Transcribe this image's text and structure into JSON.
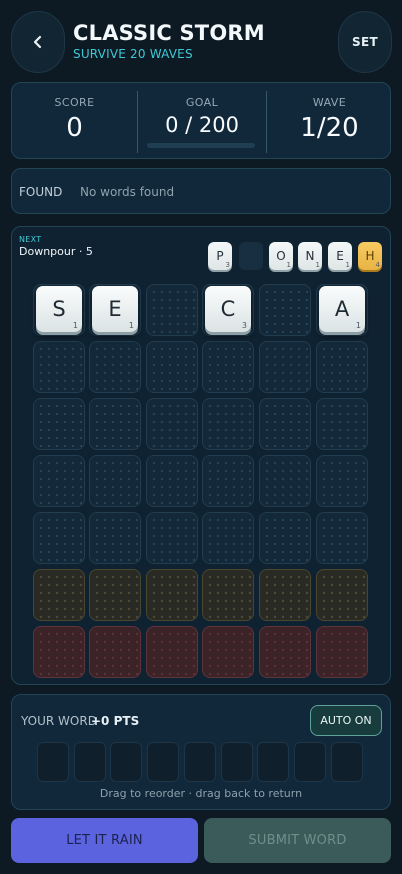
{
  "header": {
    "title": "CLASSIC STORM",
    "subtitle": "SURVIVE 20 WAVES",
    "back_icon": "chevron-left-icon",
    "set_label": "SET"
  },
  "stats": {
    "score_label": "SCORE",
    "score_value": "0",
    "goal_label": "GOAL",
    "goal_value": "0 / 200",
    "goal_progress": 0,
    "wave_label": "WAVE",
    "wave_value": "1/20"
  },
  "found": {
    "label": "FOUND",
    "text": "No words found"
  },
  "next": {
    "label": "NEXT",
    "name": "Downpour · 5",
    "queue": [
      {
        "letter": "P",
        "points": "3",
        "style": "white"
      },
      {
        "letter": "",
        "points": "",
        "style": "empty"
      },
      {
        "letter": "O",
        "points": "1",
        "style": "white"
      },
      {
        "letter": "N",
        "points": "1",
        "style": "white"
      },
      {
        "letter": "E",
        "points": "1",
        "style": "white"
      },
      {
        "letter": "H",
        "points": "4",
        "style": "gold"
      }
    ]
  },
  "board": {
    "columns": 6,
    "rows": 7,
    "row_states": [
      "normal",
      "normal",
      "normal",
      "normal",
      "normal",
      "warn",
      "danger"
    ],
    "tiles": [
      {
        "row": 0,
        "col": 0,
        "letter": "S",
        "points": "1"
      },
      {
        "row": 0,
        "col": 1,
        "letter": "E",
        "points": "1"
      },
      {
        "row": 0,
        "col": 3,
        "letter": "C",
        "points": "3"
      },
      {
        "row": 0,
        "col": 5,
        "letter": "A",
        "points": "1"
      }
    ]
  },
  "word": {
    "label": "YOUR WORD",
    "points": "+0 PTS",
    "auto_label": "AUTO ON",
    "slot_count": 9,
    "hint": "Drag to reorder · drag back to return"
  },
  "actions": {
    "rain_label": "LET IT RAIN",
    "submit_label": "SUBMIT WORD"
  },
  "colors": {
    "accent": "#3ec9d6",
    "rain_button": "#5b63de",
    "submit_button_disabled": "#3a5b5a",
    "warn_row": "#2a2a24",
    "danger_row": "#3c2327",
    "gold_tile": "#f7cb62"
  }
}
